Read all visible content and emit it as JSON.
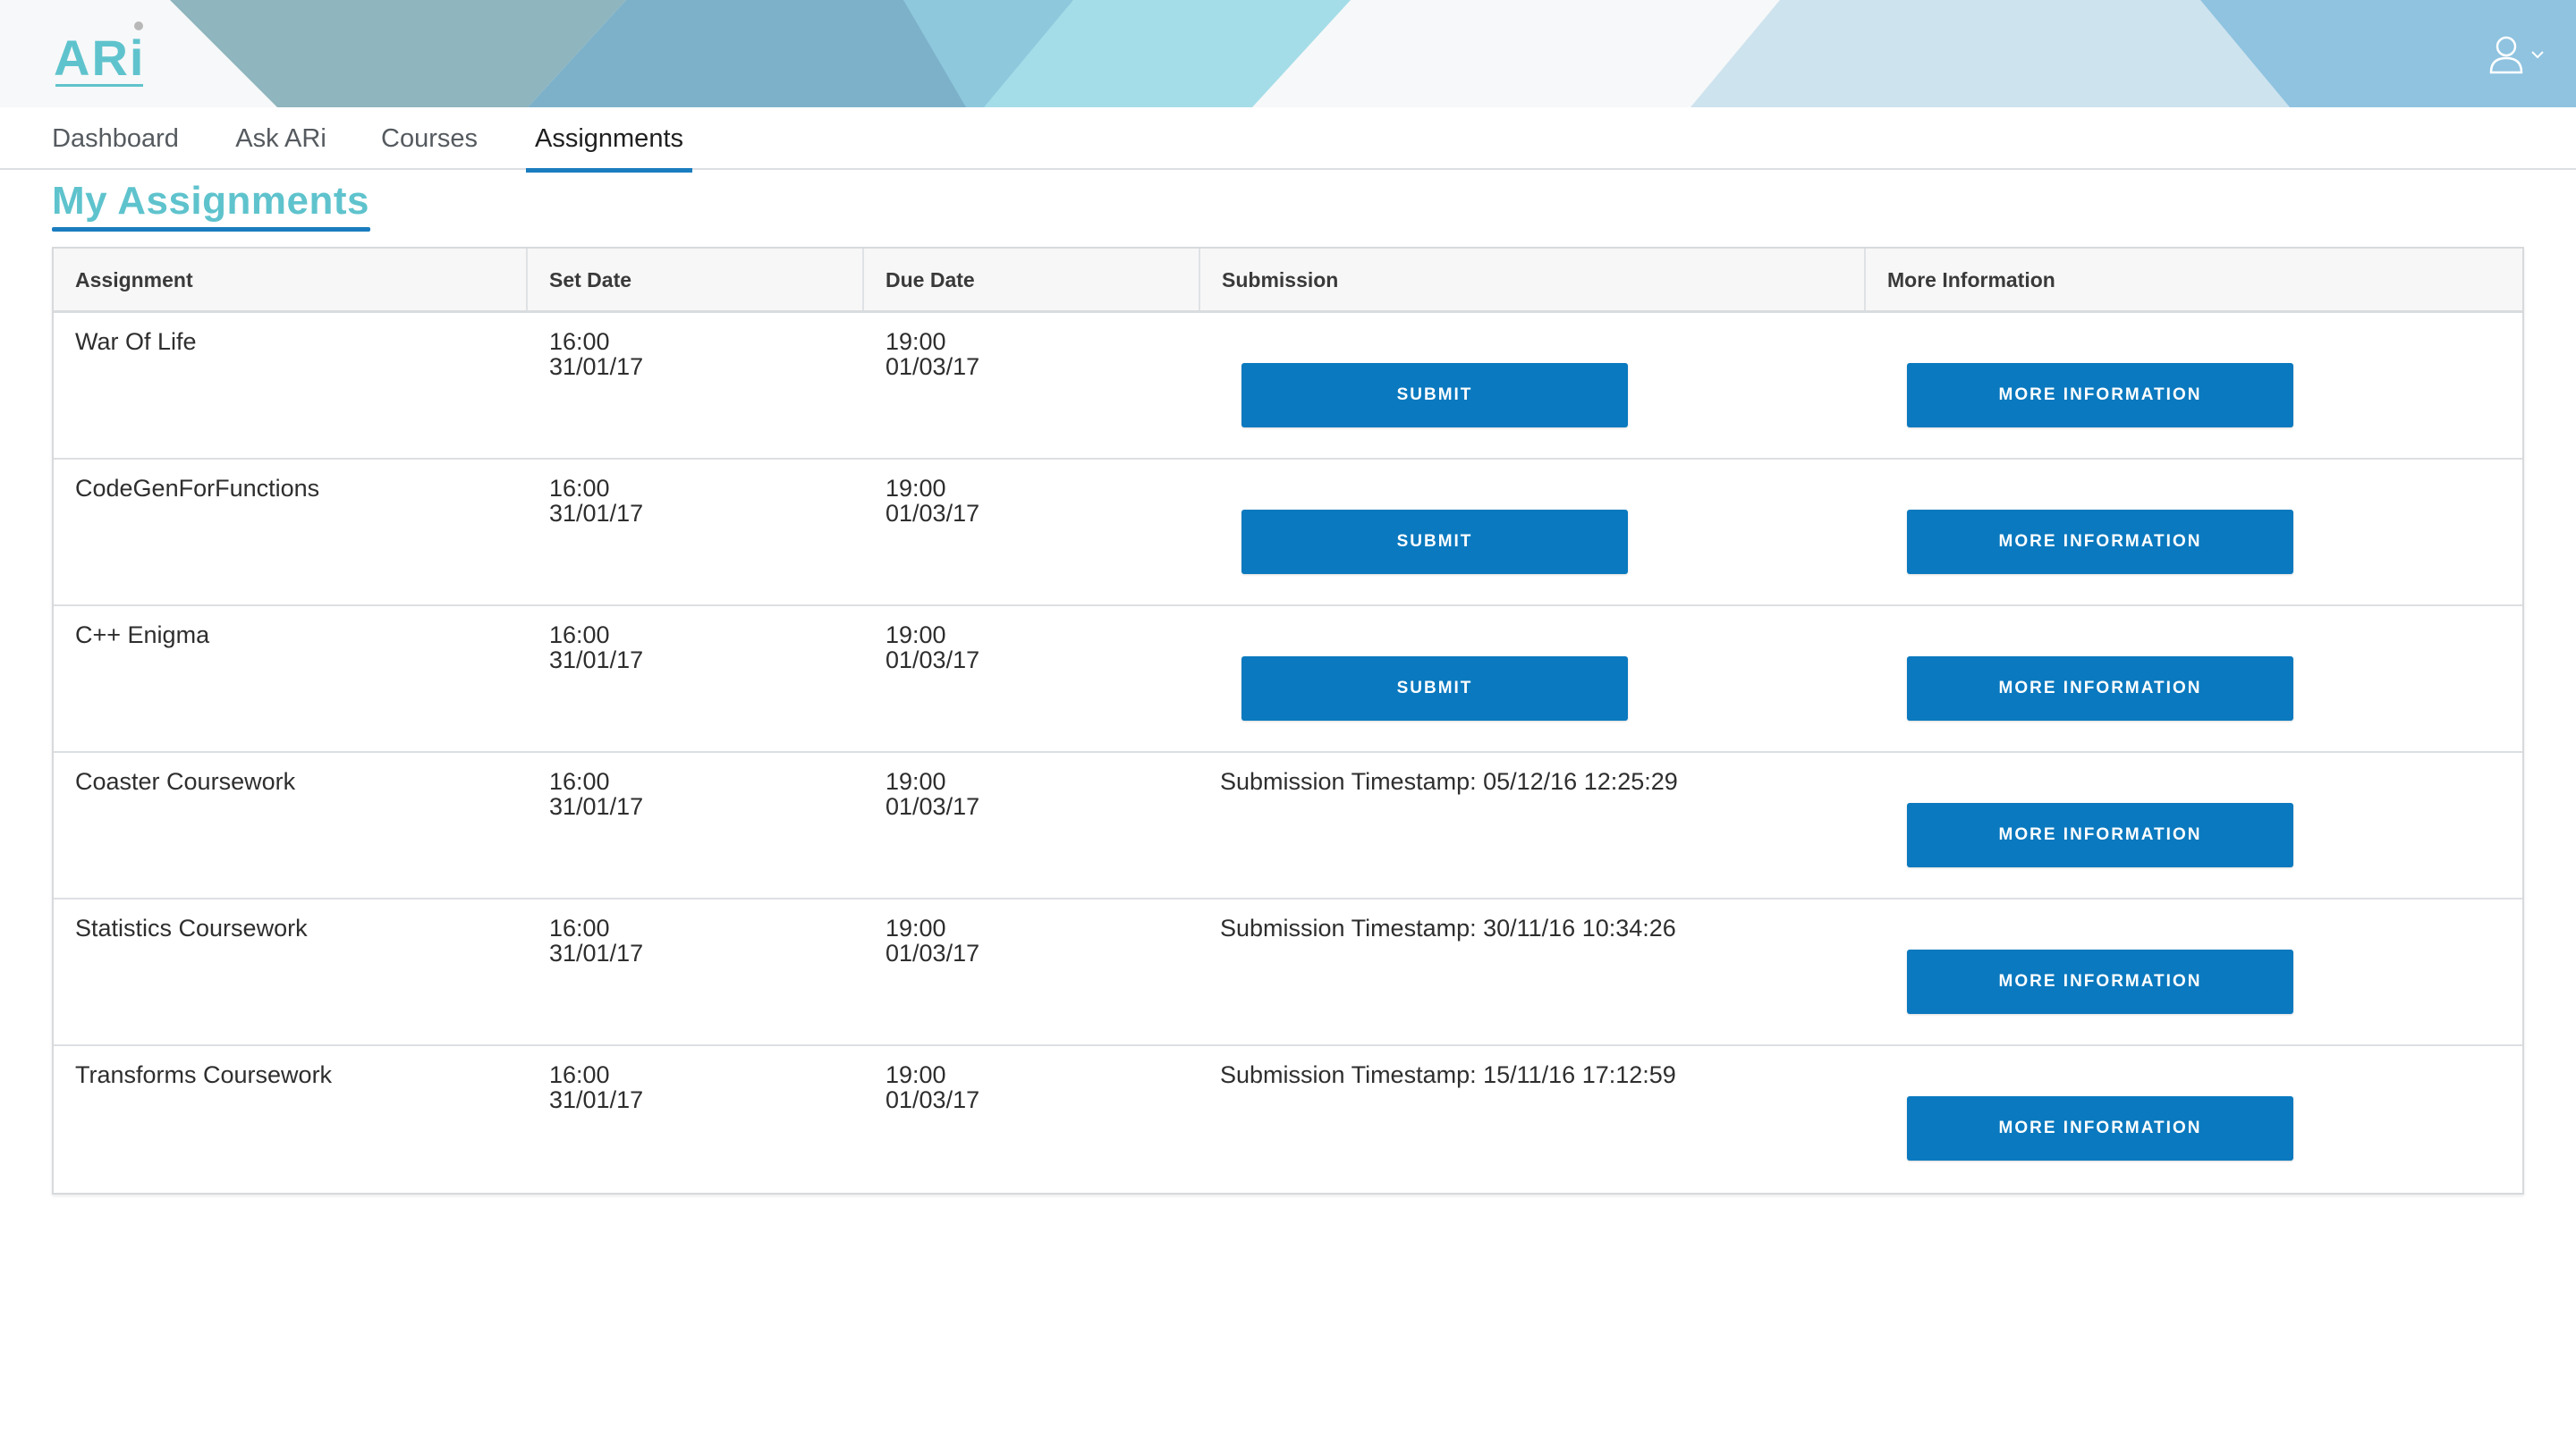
{
  "app": {
    "logo_text": "ARi"
  },
  "nav": {
    "tabs": [
      {
        "label": "Dashboard",
        "active": false
      },
      {
        "label": "Ask ARi",
        "active": false
      },
      {
        "label": "Courses",
        "active": false
      },
      {
        "label": "Assignments",
        "active": true
      }
    ]
  },
  "page": {
    "title": "My Assignments"
  },
  "table": {
    "headers": {
      "assignment": "Assignment",
      "set_date": "Set Date",
      "due_date": "Due Date",
      "submission": "Submission",
      "more_info": "More Information"
    },
    "submit_label": "SUBMIT",
    "more_info_label": "MORE INFORMATION",
    "rows": [
      {
        "name": "War Of Life",
        "set_time": "16:00",
        "set_date": "31/01/17",
        "due_time": "19:00",
        "due_date": "01/03/17",
        "submission": ""
      },
      {
        "name": "CodeGenForFunctions",
        "set_time": "16:00",
        "set_date": "31/01/17",
        "due_time": "19:00",
        "due_date": "01/03/17",
        "submission": ""
      },
      {
        "name": "C++ Enigma",
        "set_time": "16:00",
        "set_date": "31/01/17",
        "due_time": "19:00",
        "due_date": "01/03/17",
        "submission": ""
      },
      {
        "name": "Coaster Coursework",
        "set_time": "16:00",
        "set_date": "31/01/17",
        "due_time": "19:00",
        "due_date": "01/03/17",
        "submission": "Submission Timestamp: 05/12/16 12:25:29"
      },
      {
        "name": "Statistics Coursework",
        "set_time": "16:00",
        "set_date": "31/01/17",
        "due_time": "19:00",
        "due_date": "01/03/17",
        "submission": "Submission Timestamp: 30/11/16 10:34:26"
      },
      {
        "name": "Transforms Coursework",
        "set_time": "16:00",
        "set_date": "31/01/17",
        "due_time": "19:00",
        "due_date": "01/03/17",
        "submission": "Submission Timestamp: 15/11/16 17:12:59"
      }
    ]
  },
  "colors": {
    "accent": "#0a79bf",
    "title": "#5fc3cd",
    "logo": "#5fc3cd"
  },
  "icons": {
    "user": "user-icon",
    "chevron": "chevron-down-icon"
  }
}
